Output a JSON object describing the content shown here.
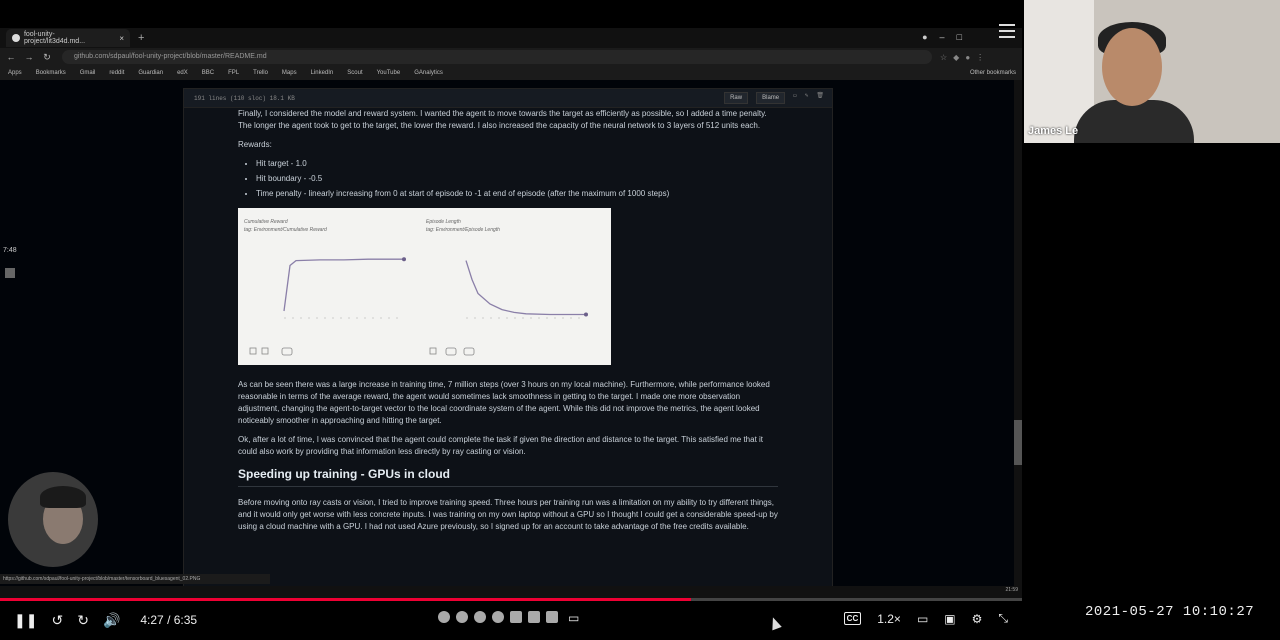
{
  "browser": {
    "tab_title": "fool-unity-project/lit3d4d.md...",
    "url": "github.com/sdpaul/fool-unity-project/blob/master/README.md",
    "bookmarks": [
      "Apps",
      "Bookmarks",
      "Gmail",
      "reddit",
      "Guardian",
      "edX",
      "BBC",
      "FPL",
      "Trello",
      "Maps",
      "LinkedIn",
      "Scout",
      "YouTube",
      "GAnalytics"
    ],
    "other_bookmarks": "Other bookmarks",
    "status_url": "https://github.com/sdpaul/fool-unity-project/blob/master/tensorboard_bluesagent_02.PNG"
  },
  "file_header": {
    "info": "191 lines (110 sloc)   18.1 KB",
    "raw_label": "Raw",
    "blame_label": "Blame"
  },
  "readme": {
    "para1": "Finally, I considered the model and reward system. I wanted the agent to move towards the target as efficiently as possible, so I added a time penalty. The longer the agent took to get to the target, the lower the reward. I also increased the capacity of the neural network to 3 layers of 512 units each.",
    "rewards_label": "Rewards:",
    "rewards": [
      "Hit target - 1.0",
      "Hit boundary - -0.5",
      "Time penalty - linearly increasing from 0 at start of episode to -1 at end of episode (after the maximum of 1000 steps)"
    ],
    "para2": "As can be seen there was a large increase in training time, 7 million steps (over 3 hours on my local machine). Furthermore, while performance looked reasonable in terms of the average reward, the agent would sometimes lack smoothness in getting to the target. I made one more observation adjustment, changing the agent-to-target vector to the local coordinate system of the agent. While this did not improve the metrics, the agent looked noticeably smoother in approaching and hitting the target.",
    "para3": "Ok, after a lot of time, I was convinced that the agent could complete the task if given the direction and distance to the target. This satisfied me that it could also work by providing that information less directly by ray casting or vision.",
    "heading": "Speeding up training - GPUs in cloud",
    "para4": "Before moving onto ray casts or vision, I tried to improve training speed. Three hours per training run was a limitation on my ability to try different things, and it would only get worse with less concrete inputs. I was training on my own laptop without a GPU so I thought I could get a considerable speed-up by using a cloud machine with a GPU. I had not used Azure previously, so I signed up for an account to take advantage of the free credits available."
  },
  "charts": {
    "left_title": "Cumulative Reward",
    "left_subtitle": "tag: Environment/Cumulative Reward",
    "right_title": "Episode Length",
    "right_subtitle": "tag: Environment/Episode Length"
  },
  "participants": {
    "remote_name": "James Le"
  },
  "side": {
    "time": "7:48"
  },
  "player": {
    "current_time": "4:27",
    "total_time": "6:35",
    "time_display": "4:27 / 6:35",
    "speed": "1.2×",
    "cc_label": "CC",
    "progress_fraction": 0.676
  },
  "overlay": {
    "datetime": "2021-05-27  10:10:27"
  },
  "taskbar": {
    "clock": "21:59"
  },
  "chart_data": [
    {
      "type": "line",
      "title": "Cumulative Reward",
      "subtitle": "tag: Environment/Cumulative Reward",
      "x": [
        0,
        0.05,
        0.1,
        0.3,
        0.5,
        0.7,
        0.9,
        1.0
      ],
      "y": [
        0.1,
        0.75,
        0.82,
        0.83,
        0.83,
        0.84,
        0.84,
        0.84
      ]
    },
    {
      "type": "line",
      "title": "Episode Length",
      "subtitle": "tag: Environment/Episode Length",
      "x": [
        0,
        0.05,
        0.1,
        0.2,
        0.3,
        0.4,
        0.5,
        0.7,
        1.0
      ],
      "y": [
        0.82,
        0.55,
        0.35,
        0.2,
        0.12,
        0.08,
        0.06,
        0.05,
        0.05
      ]
    }
  ]
}
